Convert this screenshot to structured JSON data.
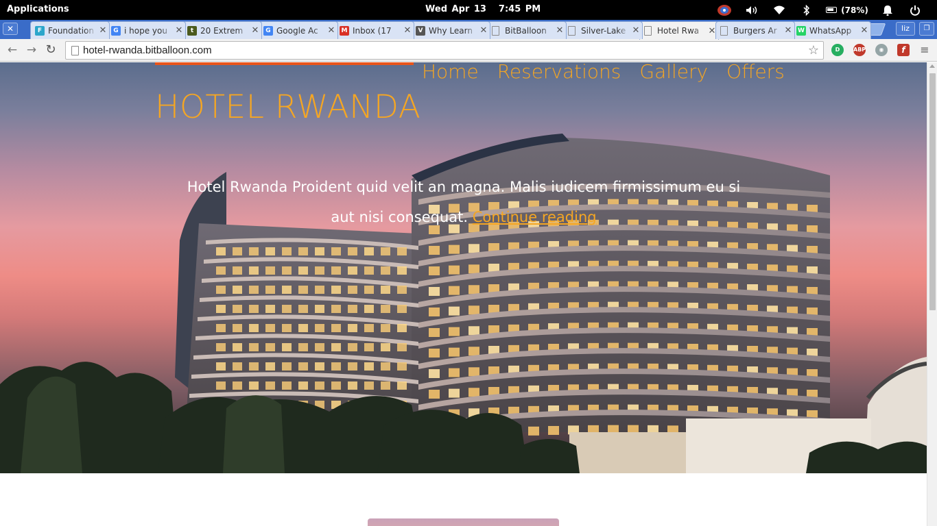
{
  "os_bar": {
    "apps_label": "Applications",
    "date": "Wed Apr 13",
    "time": "7:45 PM",
    "battery": "(78%)"
  },
  "tabs": [
    {
      "title": "Foundation",
      "favicon": "foundation-icon",
      "color": "#2ba6cb",
      "glyph": "F"
    },
    {
      "title": "i hope you",
      "favicon": "google-icon",
      "color": "#4285f4",
      "glyph": "G"
    },
    {
      "title": "20 Extrem",
      "favicon": "tuts-icon",
      "color": "#4b5a1e",
      "glyph": "t"
    },
    {
      "title": "Google Ac",
      "favicon": "google-icon",
      "color": "#4285f4",
      "glyph": "G"
    },
    {
      "title": "Inbox (17",
      "favicon": "gmail-icon",
      "color": "#d93025",
      "glyph": "M"
    },
    {
      "title": "Why Learn",
      "favicon": "site-icon",
      "color": "#555555",
      "glyph": "V"
    },
    {
      "title": "BitBalloon",
      "favicon": "page-icon",
      "color": "#888888",
      "glyph": ""
    },
    {
      "title": "Silver-Lake",
      "favicon": "page-icon",
      "color": "#888888",
      "glyph": ""
    },
    {
      "title": "Hotel Rwa",
      "favicon": "page-icon",
      "color": "#888888",
      "glyph": "",
      "active": true
    },
    {
      "title": "Burgers Ar",
      "favicon": "page-icon",
      "color": "#888888",
      "glyph": ""
    },
    {
      "title": "WhatsApp",
      "favicon": "whatsapp-icon",
      "color": "#25d366",
      "glyph": "W"
    }
  ],
  "chrome": {
    "user": "liz",
    "url": "hotel-rwanda.bitballoon.com"
  },
  "site": {
    "title": "HOTEL RWANDA",
    "nav": [
      "Home",
      "Reservations",
      "Gallery",
      "Offers"
    ],
    "tagline": "Hotel Rwanda Proident quid velit an magna. Malis iudicem firmissimum eu si aut nisi consequat.",
    "continue_label": "Continue reading",
    "accent_color": "#f5a623",
    "bar_color": "#e8551b"
  }
}
